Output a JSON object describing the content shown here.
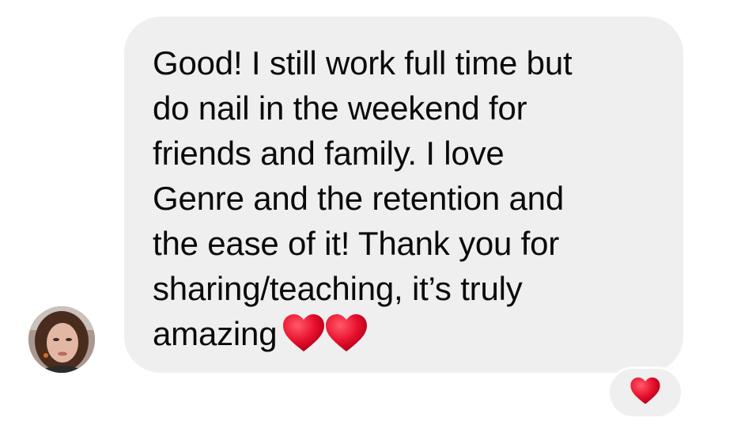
{
  "message": {
    "lines": [
      "Good! I still work full time but",
      "do nail in the weekend for",
      "friends and family. I love",
      "Genre and the retention and",
      "the ease of it! Thank you for",
      "sharing/teaching, it’s truly",
      "amazing"
    ],
    "trailing_emoji": [
      "red-heart-icon",
      "red-heart-icon"
    ]
  },
  "sender": {
    "avatar": "user-avatar"
  },
  "reaction": {
    "emoji": "red-heart-icon",
    "count": 1
  },
  "colors": {
    "bubble": "#efefef",
    "text": "#0a0a0a",
    "heart": "#e8112d",
    "background": "#ffffff"
  }
}
